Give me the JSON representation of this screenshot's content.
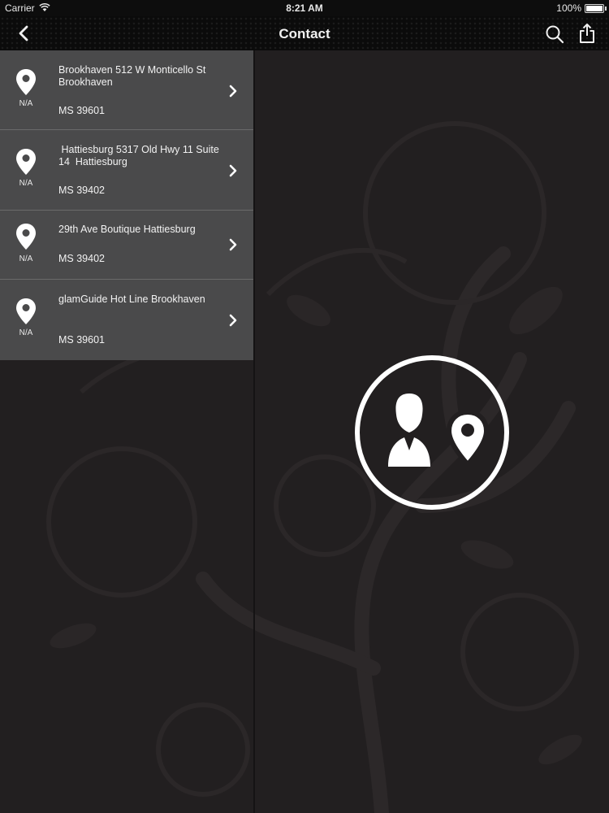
{
  "status_bar": {
    "carrier": "Carrier",
    "time": "8:21 AM",
    "battery": "100%"
  },
  "nav": {
    "title": "Contact"
  },
  "locations": [
    {
      "name": "Brookhaven 512 W Monticello St Brookhaven",
      "zip": "MS 39601",
      "distance": "N/A"
    },
    {
      "name": " Hattiesburg 5317 Old Hwy 11 Suite 14  Hattiesburg",
      "zip": "MS 39402",
      "distance": "N/A"
    },
    {
      "name": "29th Ave Boutique Hattiesburg",
      "zip": "MS 39402",
      "distance": "N/A"
    },
    {
      "name": "glamGuide Hot Line Brookhaven",
      "zip": "MS 39601",
      "distance": "N/A"
    }
  ],
  "icons": {
    "back": "chevron-left-icon",
    "search": "search-icon",
    "share": "share-icon",
    "pin": "map-pin-icon",
    "row_arrow": "chevron-right-icon",
    "placeholder": "contact-location-icon"
  },
  "colors": {
    "background": "#221f20",
    "nav_bar": "#0b0b0b",
    "list_row": "#4a4a4b",
    "text": "#ffffff"
  }
}
